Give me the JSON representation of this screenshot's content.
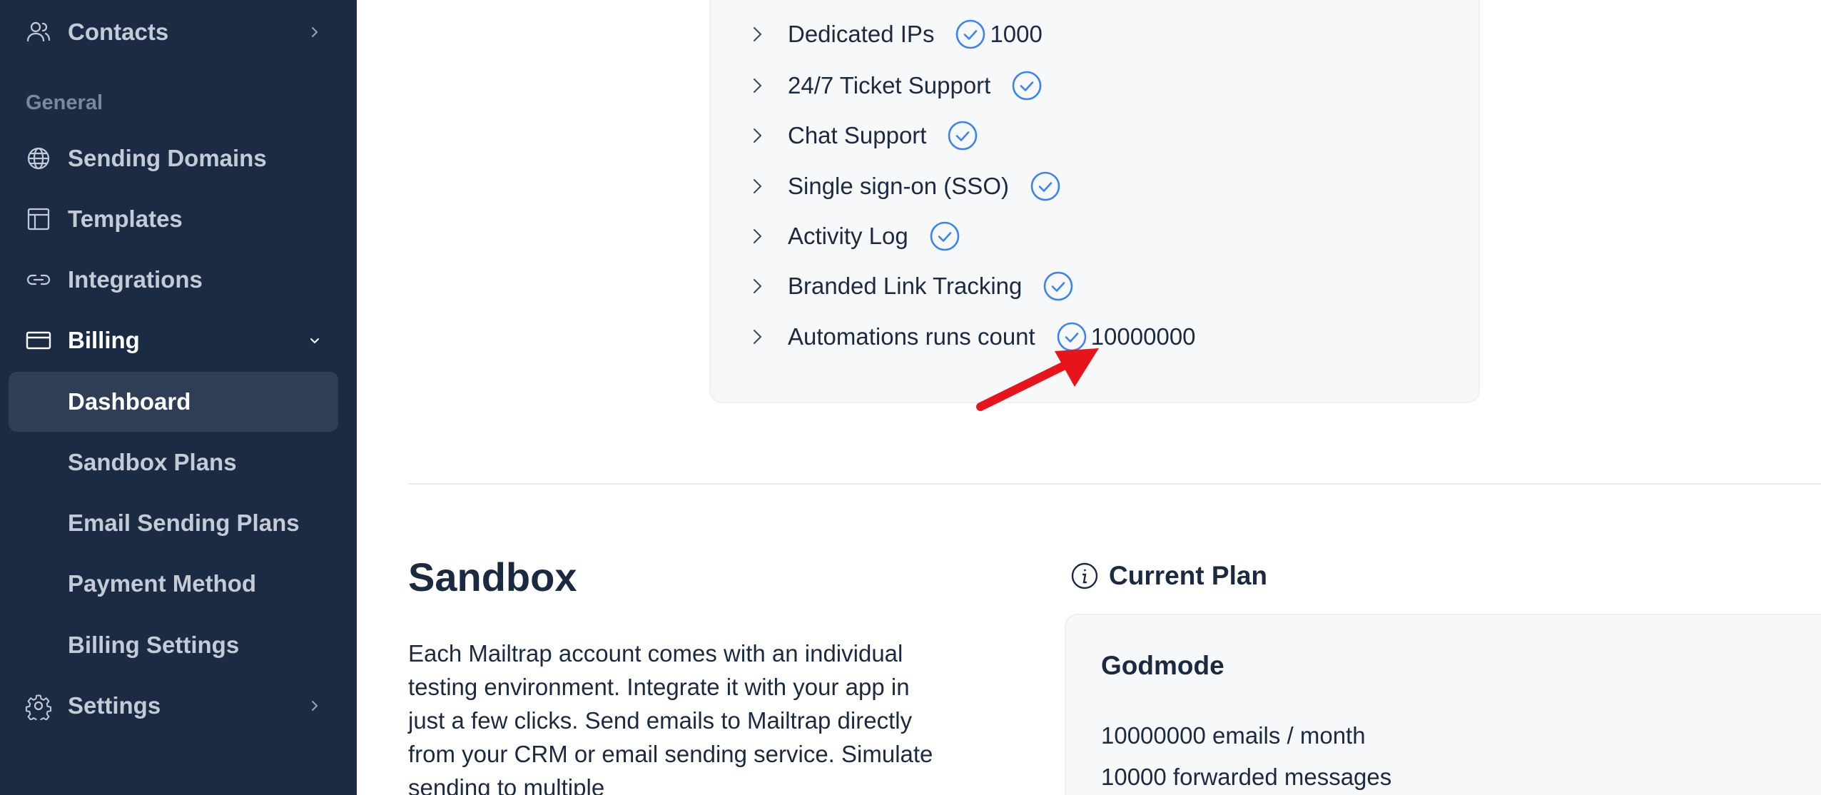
{
  "sidebar": {
    "contacts": "Contacts",
    "section_general": "General",
    "sending_domains": "Sending Domains",
    "templates": "Templates",
    "integrations": "Integrations",
    "billing": "Billing",
    "billing_children": {
      "dashboard": "Dashboard",
      "sandbox_plans": "Sandbox Plans",
      "email_sending_plans": "Email Sending Plans",
      "payment_method": "Payment Method",
      "billing_settings": "Billing Settings"
    },
    "settings": "Settings",
    "selected": "Dashboard"
  },
  "features": [
    {
      "label": "Dedicated IPs",
      "value": "1000"
    },
    {
      "label": "24/7 Ticket Support",
      "value": ""
    },
    {
      "label": "Chat Support",
      "value": ""
    },
    {
      "label": "Single sign-on (SSO)",
      "value": ""
    },
    {
      "label": "Activity Log",
      "value": ""
    },
    {
      "label": "Branded Link Tracking",
      "value": ""
    },
    {
      "label": "Automations runs count",
      "value": "10000000"
    }
  ],
  "sandbox": {
    "title": "Sandbox",
    "description": "Each Mailtrap account comes with an individual testing environment. Integrate it with your app in just a few clicks. Send emails to Mailtrap directly from your CRM or email sending service. Simulate sending to multiple"
  },
  "current_plan": {
    "heading": "Current Plan",
    "name": "Godmode",
    "lines": [
      "10000000 emails / month",
      "10000 forwarded messages"
    ]
  },
  "colors": {
    "sidebar_bg": "#1b2b43",
    "selected_bg": "#2e3e56",
    "check_blue": "#3b82f6",
    "annotation_arrow": "#e8141b"
  }
}
